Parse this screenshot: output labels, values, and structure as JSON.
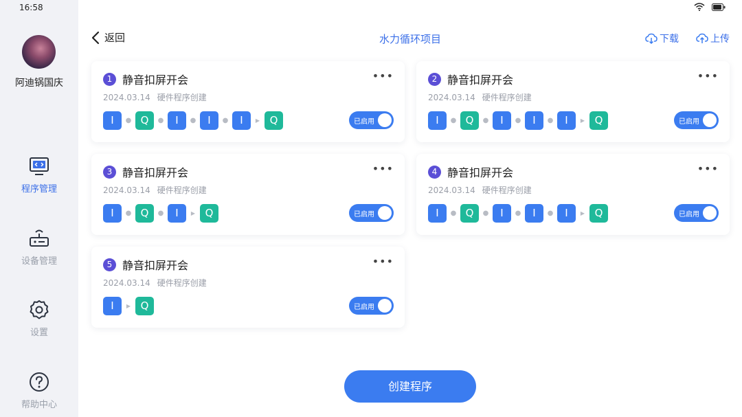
{
  "status_bar": {
    "time": "16:58"
  },
  "user": {
    "name": "阿迪锅国庆"
  },
  "nav": [
    {
      "label": "程序管理",
      "icon": "monitor-code-icon",
      "active": true
    },
    {
      "label": "设备管理",
      "icon": "router-icon",
      "active": false
    },
    {
      "label": "设置",
      "icon": "gear-icon",
      "active": false
    },
    {
      "label": "帮助中心",
      "icon": "help-circle-icon",
      "active": false
    }
  ],
  "header": {
    "back_label": "返回",
    "title": "水力循环项目",
    "download_label": "下载",
    "upload_label": "上传"
  },
  "programs": [
    {
      "num": "1",
      "title": "静音扣屏开会",
      "date": "2024.03.14",
      "source": "硬件程序创建",
      "steps": [
        "I",
        "Q",
        "I",
        "I",
        "I",
        "Q"
      ],
      "toggle_label": "已启用",
      "enabled": true
    },
    {
      "num": "2",
      "title": "静音扣屏开会",
      "date": "2024.03.14",
      "source": "硬件程序创建",
      "steps": [
        "I",
        "Q",
        "I",
        "I",
        "I",
        "Q"
      ],
      "toggle_label": "已启用",
      "enabled": true
    },
    {
      "num": "3",
      "title": "静音扣屏开会",
      "date": "2024.03.14",
      "source": "硬件程序创建",
      "steps": [
        "I",
        "Q",
        "I",
        "Q"
      ],
      "toggle_label": "已启用",
      "enabled": true
    },
    {
      "num": "4",
      "title": "静音扣屏开会",
      "date": "2024.03.14",
      "source": "硬件程序创建",
      "steps": [
        "I",
        "Q",
        "I",
        "I",
        "I",
        "Q"
      ],
      "toggle_label": "已启用",
      "enabled": true
    },
    {
      "num": "5",
      "title": "静音扣屏开会",
      "date": "2024.03.14",
      "source": "硬件程序创建",
      "steps": [
        "I",
        "Q"
      ],
      "toggle_label": "已启用",
      "enabled": true
    }
  ],
  "more_label": "•••",
  "create_button": "创建程序",
  "colors": {
    "accent": "#3b7cf0",
    "step_i": "#3b7cf0",
    "step_q": "#1fb99a",
    "badge": "#5b4fd6"
  }
}
